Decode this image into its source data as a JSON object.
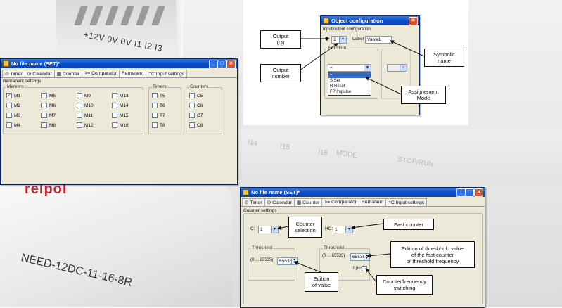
{
  "photo": {
    "terminal_text": "+12V 0V  0V  I1  I2  I3",
    "brand": "relpol",
    "model": "NEED-12DC-11-16-8R",
    "silk": [
      "I14",
      "I15",
      "I16",
      "MODE",
      "STOP/RUN"
    ]
  },
  "remanent_window": {
    "title": "No file name (SET)*",
    "tabs": [
      "Timer",
      "Calendar",
      "Counter",
      "Comparator",
      "Remanent",
      "Input settings"
    ],
    "section": "Remanent settings",
    "markers_label": "Markers",
    "markers": [
      {
        "label": "M1",
        "checked": true
      },
      {
        "label": "M5",
        "checked": false
      },
      {
        "label": "M9",
        "checked": false
      },
      {
        "label": "M13",
        "checked": false
      },
      {
        "label": "M2",
        "checked": false
      },
      {
        "label": "M6",
        "checked": false
      },
      {
        "label": "M10",
        "checked": false
      },
      {
        "label": "M14",
        "checked": false
      },
      {
        "label": "M3",
        "checked": false
      },
      {
        "label": "M7",
        "checked": false
      },
      {
        "label": "M11",
        "checked": false
      },
      {
        "label": "M15",
        "checked": false
      },
      {
        "label": "M4",
        "checked": false
      },
      {
        "label": "M8",
        "checked": false
      },
      {
        "label": "M12",
        "checked": false
      },
      {
        "label": "M16",
        "checked": false
      }
    ],
    "timers_label": "Timers",
    "timers": [
      "T5",
      "T6",
      "T7",
      "T8"
    ],
    "counters_label": "Counters",
    "counters": [
      "C5",
      "C6",
      "C7",
      "C8"
    ]
  },
  "object_config": {
    "title": "Object configuration",
    "section": "Input/output configuration",
    "output_prefix": "Q",
    "output_value": "1",
    "label_caption": "Label",
    "label_value": "Valve1",
    "function_label": "Function",
    "function_value": "=",
    "list_items": [
      "=",
      "S  Set",
      "R  Reset",
      "FP Impulse"
    ],
    "callouts": {
      "output": "Output\n(Q)",
      "output_number": "Output\nnumber",
      "symbolic": "Symbolic\nname",
      "assignment": "Assignement\nMode"
    }
  },
  "counter_window": {
    "title": "No file name (SET)*",
    "tabs": [
      "Timer",
      "Calendar",
      "Counter",
      "Comparator",
      "Remanent",
      "Input settings"
    ],
    "section": "Counter settings",
    "c_label": "C:",
    "c_value": "1",
    "hc_label": "HC:",
    "hc_value": "1",
    "threshold1_label": "Threshold",
    "threshold1_range": "(0 ... 65535)",
    "threshold1_value": "65535",
    "threshold2_label": "Threshold",
    "threshold2_range": "(0 ... 65535)",
    "threshold2_value": "65535",
    "fhz_label": "f (Hz)",
    "callouts": {
      "counter_selection": "Counter\nselection",
      "fast_counter": "Fast counter",
      "edition_threshold": "Edition of threshhold value\nof the fast counter\nor threshold frequency",
      "edition_value": "Edition\nof value",
      "counter_freq": "Counter/frequency\nswitching"
    }
  }
}
